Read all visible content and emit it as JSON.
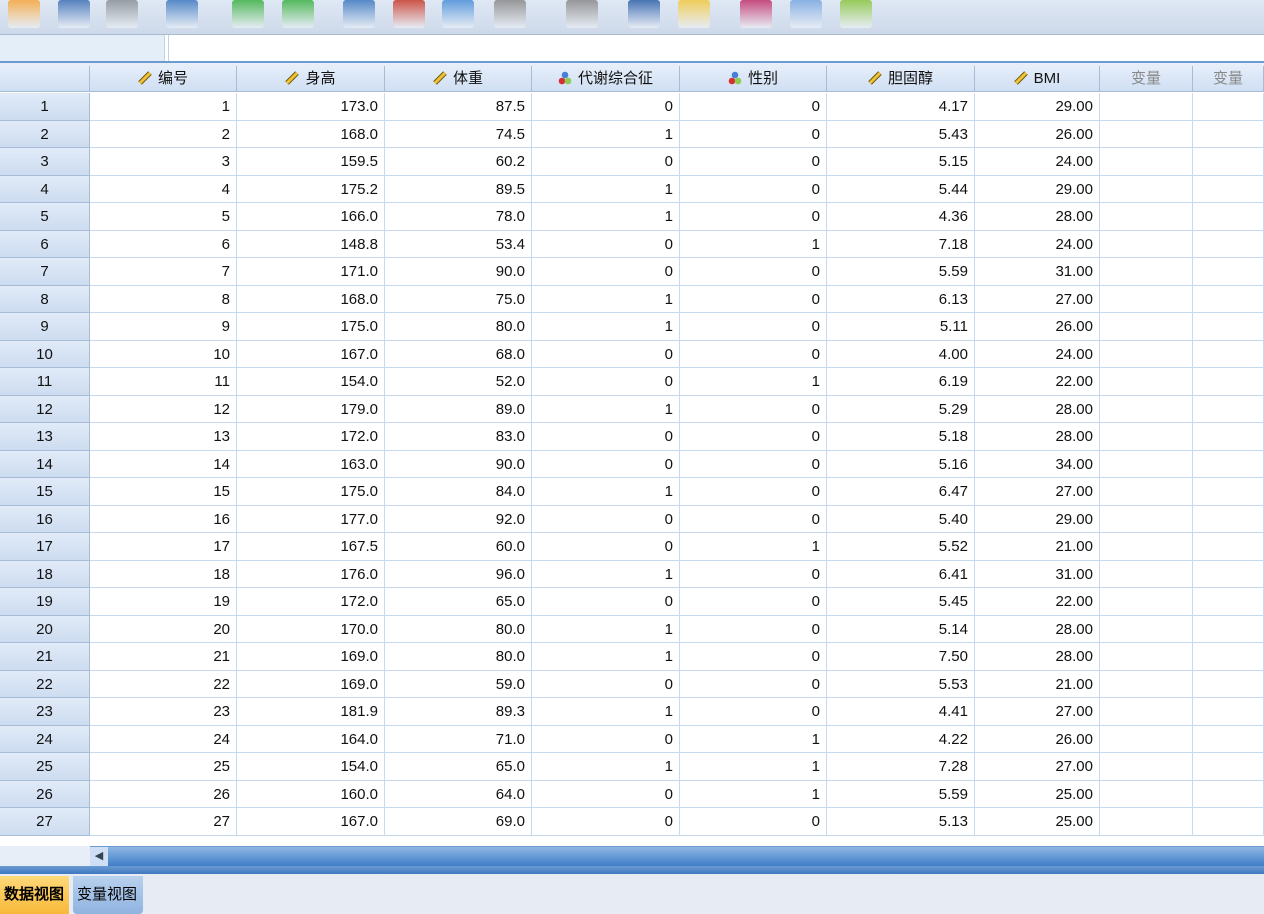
{
  "toolbar": {
    "icons": [
      "open-folder-icon",
      "save-icon",
      "print-icon",
      "recall-dialog-icon",
      "undo-icon",
      "redo-icon",
      "goto-case-icon",
      "goto-variable-icon",
      "variables-icon",
      "find-disabled-icon",
      "binoculars-icon",
      "insert-cases-icon",
      "split-file-icon",
      "weight-cases-icon",
      "value-labels-icon",
      "add-icon"
    ]
  },
  "columns": [
    {
      "label": "编号",
      "icon": "ruler-scale-icon"
    },
    {
      "label": "身高",
      "icon": "ruler-scale-icon"
    },
    {
      "label": "体重",
      "icon": "ruler-scale-icon"
    },
    {
      "label": "代谢综合征",
      "icon": "nominal-circles-icon"
    },
    {
      "label": "性别",
      "icon": "nominal-circles-icon"
    },
    {
      "label": "胆固醇",
      "icon": "ruler-scale-icon"
    },
    {
      "label": "BMI",
      "icon": "ruler-scale-icon"
    },
    {
      "label": "变量",
      "icon": ""
    },
    {
      "label": "变量",
      "icon": ""
    }
  ],
  "rows": [
    [
      "1",
      "1",
      "173.0",
      "87.5",
      "0",
      "0",
      "4.17",
      "29.00"
    ],
    [
      "2",
      "2",
      "168.0",
      "74.5",
      "1",
      "0",
      "5.43",
      "26.00"
    ],
    [
      "3",
      "3",
      "159.5",
      "60.2",
      "0",
      "0",
      "5.15",
      "24.00"
    ],
    [
      "4",
      "4",
      "175.2",
      "89.5",
      "1",
      "0",
      "5.44",
      "29.00"
    ],
    [
      "5",
      "5",
      "166.0",
      "78.0",
      "1",
      "0",
      "4.36",
      "28.00"
    ],
    [
      "6",
      "6",
      "148.8",
      "53.4",
      "0",
      "1",
      "7.18",
      "24.00"
    ],
    [
      "7",
      "7",
      "171.0",
      "90.0",
      "0",
      "0",
      "5.59",
      "31.00"
    ],
    [
      "8",
      "8",
      "168.0",
      "75.0",
      "1",
      "0",
      "6.13",
      "27.00"
    ],
    [
      "9",
      "9",
      "175.0",
      "80.0",
      "1",
      "0",
      "5.11",
      "26.00"
    ],
    [
      "10",
      "10",
      "167.0",
      "68.0",
      "0",
      "0",
      "4.00",
      "24.00"
    ],
    [
      "11",
      "11",
      "154.0",
      "52.0",
      "0",
      "1",
      "6.19",
      "22.00"
    ],
    [
      "12",
      "12",
      "179.0",
      "89.0",
      "1",
      "0",
      "5.29",
      "28.00"
    ],
    [
      "13",
      "13",
      "172.0",
      "83.0",
      "0",
      "0",
      "5.18",
      "28.00"
    ],
    [
      "14",
      "14",
      "163.0",
      "90.0",
      "0",
      "0",
      "5.16",
      "34.00"
    ],
    [
      "15",
      "15",
      "175.0",
      "84.0",
      "1",
      "0",
      "6.47",
      "27.00"
    ],
    [
      "16",
      "16",
      "177.0",
      "92.0",
      "0",
      "0",
      "5.40",
      "29.00"
    ],
    [
      "17",
      "17",
      "167.5",
      "60.0",
      "0",
      "1",
      "5.52",
      "21.00"
    ],
    [
      "18",
      "18",
      "176.0",
      "96.0",
      "1",
      "0",
      "6.41",
      "31.00"
    ],
    [
      "19",
      "19",
      "172.0",
      "65.0",
      "0",
      "0",
      "5.45",
      "22.00"
    ],
    [
      "20",
      "20",
      "170.0",
      "80.0",
      "1",
      "0",
      "5.14",
      "28.00"
    ],
    [
      "21",
      "21",
      "169.0",
      "80.0",
      "1",
      "0",
      "7.50",
      "28.00"
    ],
    [
      "22",
      "22",
      "169.0",
      "59.0",
      "0",
      "0",
      "5.53",
      "21.00"
    ],
    [
      "23",
      "23",
      "181.9",
      "89.3",
      "1",
      "0",
      "4.41",
      "27.00"
    ],
    [
      "24",
      "24",
      "164.0",
      "71.0",
      "0",
      "1",
      "4.22",
      "26.00"
    ],
    [
      "25",
      "25",
      "154.0",
      "65.0",
      "1",
      "1",
      "7.28",
      "27.00"
    ],
    [
      "26",
      "26",
      "160.0",
      "64.0",
      "0",
      "1",
      "5.59",
      "25.00"
    ],
    [
      "27",
      "27",
      "167.0",
      "69.0",
      "0",
      "0",
      "5.13",
      "25.00"
    ]
  ],
  "tabs": {
    "data_view": "数据视图",
    "variable_view": "变量视图"
  },
  "colors": {
    "accent": "#3e78c0",
    "active_tab": "#f7b93a",
    "header": "#cfdff3"
  }
}
